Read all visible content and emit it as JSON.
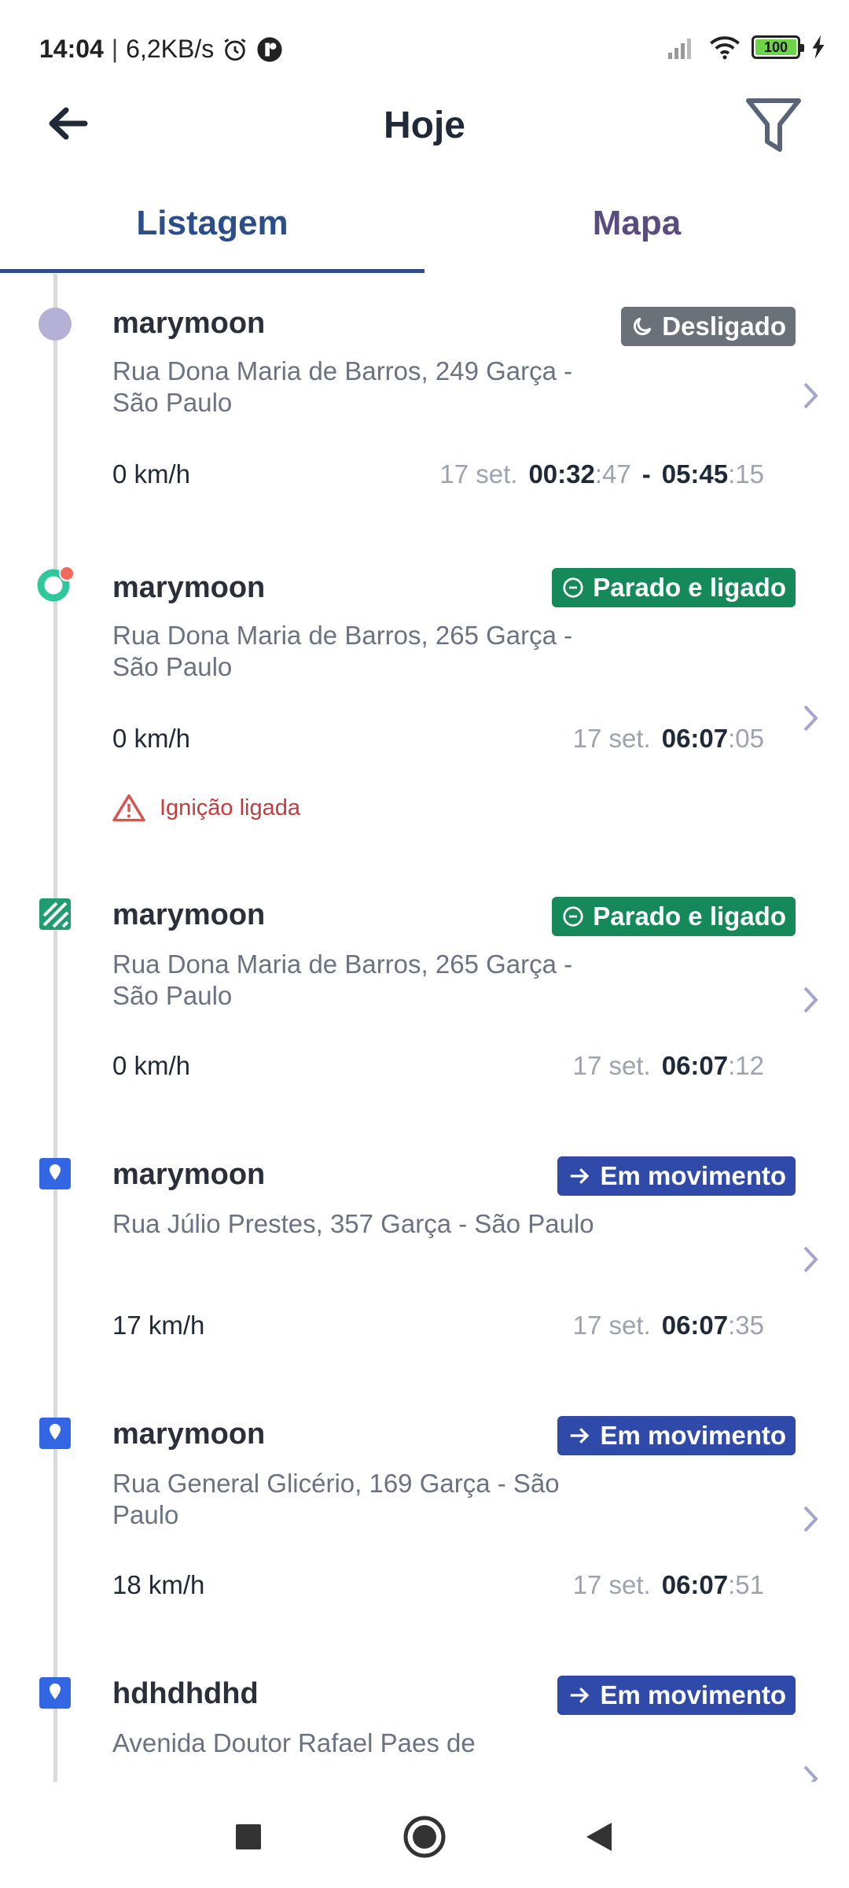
{
  "status_bar": {
    "time": "14:04",
    "speed": "6,2KB/s",
    "battery": "100"
  },
  "header": {
    "title": "Hoje"
  },
  "tabs": [
    {
      "label": "Listagem"
    },
    {
      "label": "Mapa"
    }
  ],
  "items": [
    {
      "name": "marymoon",
      "status": "Desligado",
      "status_icon": "moon-icon",
      "status_color": "#6b7178",
      "address": "Rua Dona Maria de Barros, 249 Garça - São Paulo",
      "speed": "0 km/h",
      "date": "17 set.",
      "start_hm": "00:32",
      "start_sec": ":47",
      "sep": "-",
      "end_hm": "05:45",
      "end_sec": ":15",
      "marker": "gray-dot-icon"
    },
    {
      "name": "marymoon",
      "status": "Parado e ligado",
      "status_icon": "minus-circle-icon",
      "status_color": "#15895a",
      "address": "Rua Dona Maria de Barros, 265 Garça - São Paulo",
      "speed": "0 km/h",
      "date": "17 set.",
      "hm": "06:07",
      "sec": ":05",
      "alert": "Ignição ligada",
      "marker": "green-ring-icon"
    },
    {
      "name": "marymoon",
      "status": "Parado e ligado",
      "status_icon": "minus-circle-icon",
      "status_color": "#15895a",
      "address": "Rua Dona Maria de Barros, 265 Garça - São Paulo",
      "speed": "0 km/h",
      "date": "17 set.",
      "hm": "06:07",
      "sec": ":12",
      "marker": "striped-square-icon"
    },
    {
      "name": "marymoon",
      "status": "Em movimento",
      "status_icon": "arrow-right-icon",
      "status_color": "#2f4aa8",
      "address": "Rua Júlio Prestes, 357 Garça - São Paulo",
      "speed": "17 km/h",
      "date": "17 set.",
      "hm": "06:07",
      "sec": ":35",
      "marker": "blue-pin-icon"
    },
    {
      "name": "marymoon",
      "status": "Em movimento",
      "status_icon": "arrow-right-icon",
      "status_color": "#2f4aa8",
      "address": "Rua General Glicério, 169 Garça - São Paulo",
      "speed": "18 km/h",
      "date": "17 set.",
      "hm": "06:07",
      "sec": ":51",
      "marker": "blue-pin-icon"
    },
    {
      "name": "hdhdhdhd",
      "status": "Em movimento",
      "status_icon": "arrow-right-icon",
      "status_color": "#2f4aa8",
      "address": "Avenida Doutor Rafael Paes de",
      "marker": "blue-pin-icon"
    }
  ]
}
